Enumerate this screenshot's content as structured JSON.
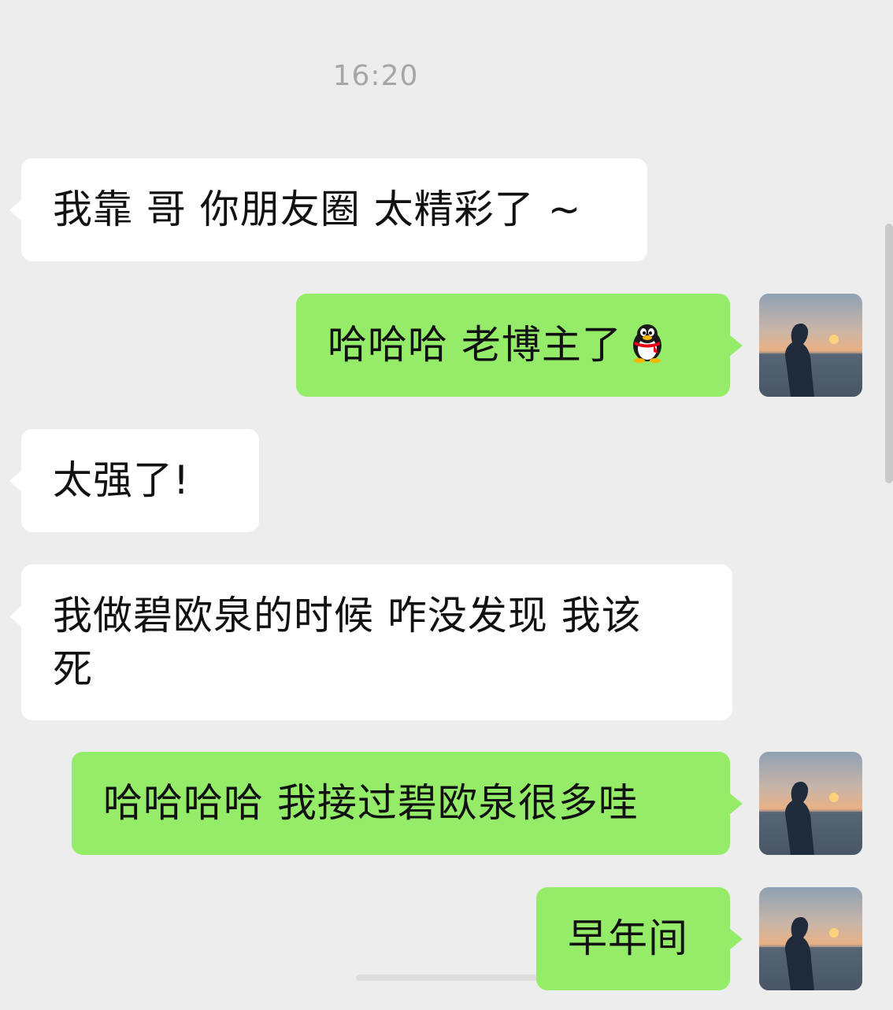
{
  "timestamp": "16:20",
  "messages": [
    {
      "side": "in",
      "text": "我靠 哥 你朋友圈 太精彩了 ~"
    },
    {
      "side": "out",
      "text": "哈哈哈 老博主了",
      "emoji": "qq-penguin-icon"
    },
    {
      "side": "in",
      "text": "太强了!"
    },
    {
      "side": "in",
      "line1": "我做碧欧泉的时候 咋没发现 我该",
      "line2": "死"
    },
    {
      "side": "out",
      "text": "哈哈哈哈 我接过碧欧泉很多哇"
    },
    {
      "side": "out",
      "text": "早年间"
    }
  ],
  "colors": {
    "background": "#ededed",
    "incoming_bubble": "#ffffff",
    "outgoing_bubble": "#95ec69",
    "timestamp_text": "#a6a6a6",
    "message_text": "#111111"
  }
}
